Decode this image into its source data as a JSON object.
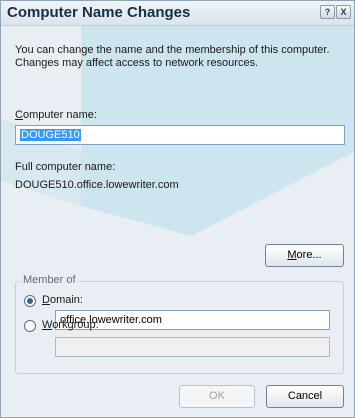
{
  "window": {
    "title": "Computer Name Changes",
    "help_glyph": "?",
    "close_glyph": "X"
  },
  "description": "You can change the name and the membership of this computer. Changes may affect access to network resources.",
  "computer_name": {
    "label_mnemonic": "C",
    "label_rest": "omputer name:",
    "value": "DOUGE510"
  },
  "full_name": {
    "label": "Full computer name:",
    "value": "DOUGE510.office.lowewriter.com"
  },
  "more_button": {
    "mnemonic": "M",
    "rest": "ore..."
  },
  "member_of": {
    "label": "Member of",
    "domain": {
      "label_mnemonic": "D",
      "label_rest": "omain:",
      "value": "office.lowewriter.com",
      "selected": true
    },
    "workgroup": {
      "label_mnemonic": "W",
      "label_rest": "orkgroup:",
      "value": "",
      "selected": false
    }
  },
  "buttons": {
    "ok": "OK",
    "cancel": "Cancel"
  },
  "colors": {
    "background": "#e8eef3",
    "title_text": "#1b2e44",
    "selection": "#3399ff",
    "watermark": "#b9dbe8"
  }
}
